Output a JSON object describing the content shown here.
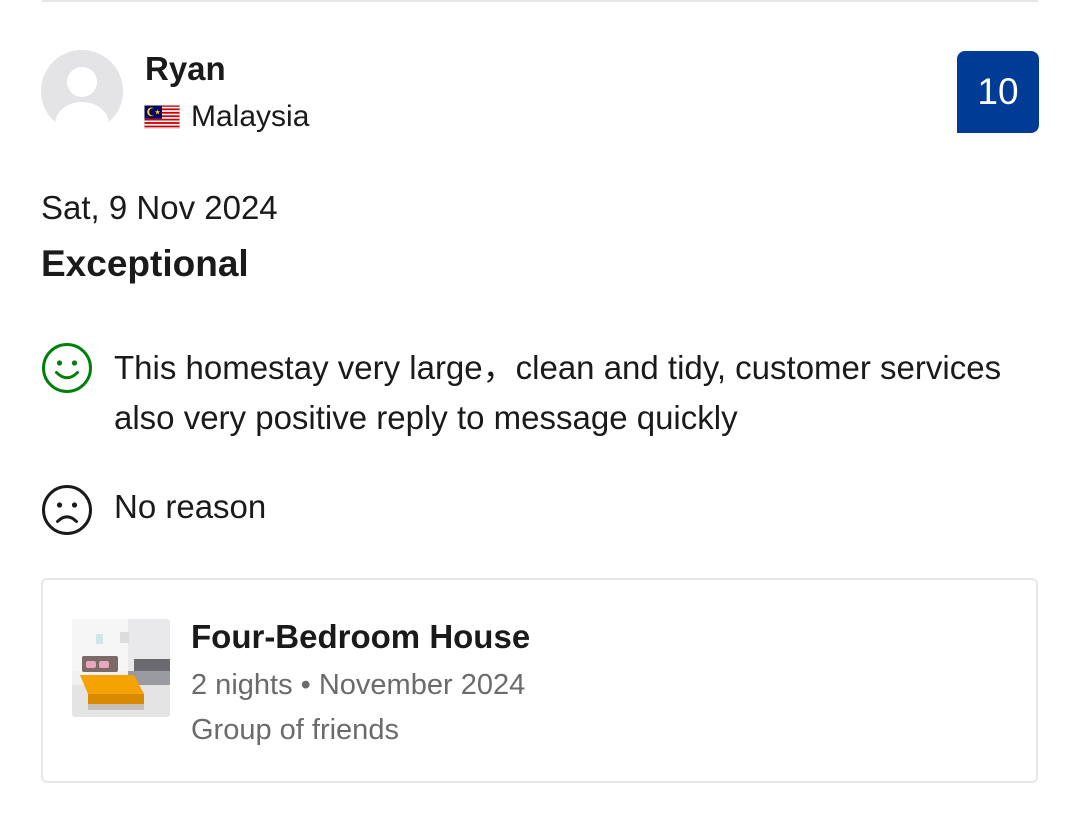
{
  "reviewer": {
    "name": "Ryan",
    "country": "Malaysia",
    "flag_icon": "malaysia-flag-icon",
    "avatar_icon": "default-avatar-icon"
  },
  "score": {
    "value": "10",
    "badge_color": "#003b95"
  },
  "review": {
    "date": "Sat, 9 Nov 2024",
    "title": "Exceptional",
    "positive": {
      "icon": "smiley-face-icon",
      "icon_color": "#008009",
      "text": "This homestay very large，clean and tidy, customer services also very positive reply to message quickly"
    },
    "negative": {
      "icon": "frown-face-icon",
      "text": "No reason"
    }
  },
  "stay": {
    "room_name": "Four-Bedroom House",
    "nights": "2 nights",
    "separator": "•",
    "month": "November 2024",
    "traveller_type": "Group of friends"
  }
}
